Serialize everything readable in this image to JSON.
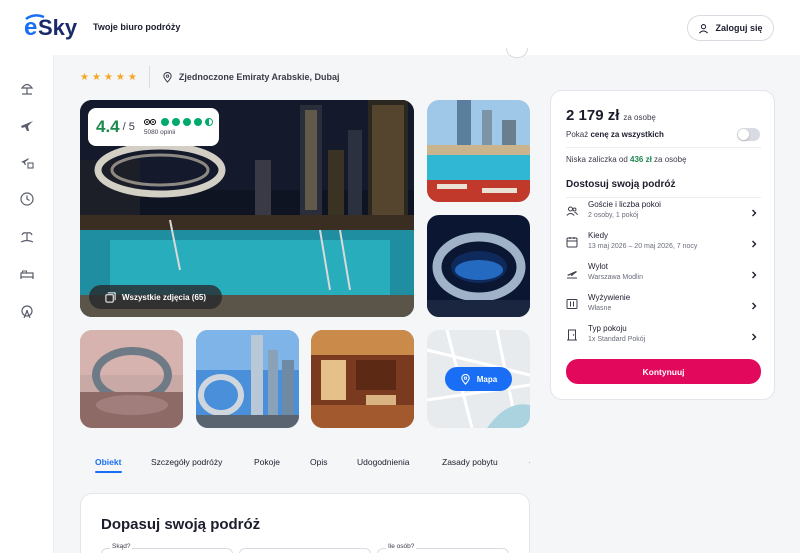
{
  "header": {
    "tagline": "Twoje biuro podróży",
    "login_label": "Zaloguj się",
    "brand_color": "#1a6ef5"
  },
  "sidebar": {
    "icons": [
      "beach-umbrella-icon",
      "plane-icon",
      "plane-hotel-icon",
      "clock-icon",
      "island-icon",
      "bed-icon",
      "ferris-wheel-icon"
    ]
  },
  "hotel": {
    "stars": 5,
    "location": "Zjednoczone Emiraty Arabskie, Dubaj"
  },
  "review": {
    "score": "4.4",
    "max": "/ 5",
    "opinions": "5080 opinii",
    "bubbles_rating": 4.5
  },
  "gallery": {
    "all_photos_label": "Wszystkie zdjęcia (65)",
    "map_label": "Mapa"
  },
  "tabs": [
    {
      "label": "Obiekt",
      "active": true
    },
    {
      "label": "Szczegóły podróży",
      "active": false
    },
    {
      "label": "Pokoje",
      "active": false
    },
    {
      "label": "Opis",
      "active": false
    },
    {
      "label": "Udogodnienia",
      "active": false
    },
    {
      "label": "Zasady pobytu",
      "active": false
    }
  ],
  "bottom_form": {
    "title": "Dopasuj swoją podróż",
    "from_label": "Skąd?",
    "guests_label": "Ile osób?"
  },
  "booking": {
    "price": "2 179 zł",
    "price_unit": "za osobę",
    "show_all_prefix": "Pokaż ",
    "show_all_bold": "cenę za wszystkich",
    "toggle_on": false,
    "deposit_prefix": "Niska zaliczka od ",
    "deposit_amount": "436 zł",
    "deposit_suffix": " za osobę",
    "customize_title": "Dostosuj swoją podróż",
    "options": [
      {
        "icon": "guests-icon",
        "title": "Goście i liczba pokoi",
        "sub": "2 osoby, 1 pokój"
      },
      {
        "icon": "calendar-icon",
        "title": "Kiedy",
        "sub": "13 maj 2026 – 20 maj 2026, 7 nocy"
      },
      {
        "icon": "plane-departure-icon",
        "title": "Wylot",
        "sub": "Warszawa Modlin"
      },
      {
        "icon": "cutlery-icon",
        "title": "Wyżywienie",
        "sub": "Własne"
      },
      {
        "icon": "door-icon",
        "title": "Typ pokoju",
        "sub": "1x Standard Pokój"
      }
    ],
    "cta_label": "Kontynuuj",
    "cta_color": "#e2085c"
  }
}
